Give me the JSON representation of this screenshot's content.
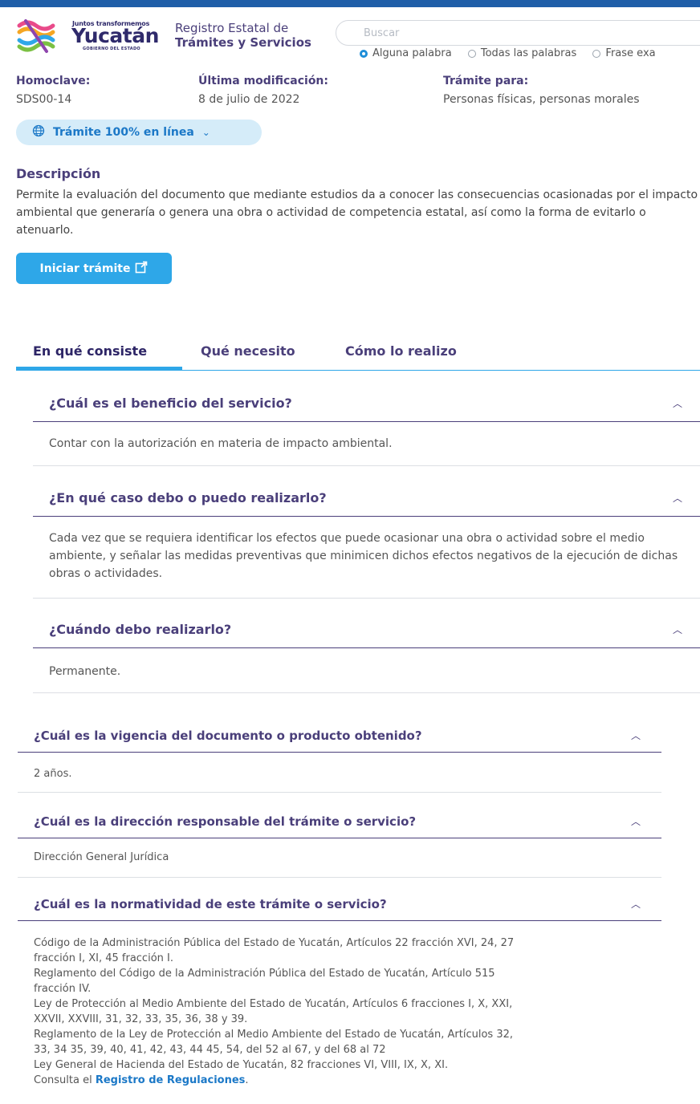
{
  "brand": {
    "tagline": "Juntos transformemos",
    "name": "Yucatán",
    "subtitle": "GOBIERNO DEL ESTADO",
    "registry_line1": "Registro Estatal de",
    "registry_line2": "Trámites y Servicios"
  },
  "search": {
    "placeholder": "Buscar",
    "options": [
      "Alguna palabra",
      "Todas las palabras",
      "Frase exa"
    ],
    "selected": "Alguna palabra"
  },
  "meta": {
    "homoclave_label": "Homoclave:",
    "homoclave_value": "SDS00-14",
    "modified_label": "Última modificación:",
    "modified_value": "8 de julio de 2022",
    "for_label": "Trámite para:",
    "for_value": "Personas físicas, personas morales"
  },
  "online_chip": "Trámite 100% en línea",
  "description": {
    "title": "Descripción",
    "text": "Permite la evaluación del documento que mediante estudios da a conocer las consecuencias ocasionadas por el impacto ambiental que generaría o genera una obra o actividad de competencia estatal, así como la forma de evitarlo o atenuarlo."
  },
  "start_button": "Iniciar trámite",
  "tabs": [
    "En qué consiste",
    "Qué necesito",
    "Cómo lo realizo"
  ],
  "active_tab": "En qué consiste",
  "accordions": [
    {
      "q": "¿Cuál es el beneficio del servicio?",
      "a": "Contar con la autorización en materia de impacto ambiental."
    },
    {
      "q": "¿En qué caso debo o puedo realizarlo?",
      "a": "Cada vez que se requiera identificar los efectos que puede ocasionar una obra o actividad sobre el medio ambiente, y señalar las medidas preventivas que minimicen dichos efectos negativos de la ejecución de dichas obras o actividades."
    },
    {
      "q": "¿Cuándo debo realizarlo?",
      "a": "Permanente."
    },
    {
      "q": "¿Cuál es la vigencia del documento o producto obtenido?",
      "a": "2 años."
    },
    {
      "q": "¿Cuál es la dirección responsable del trámite o servicio?",
      "a": "Dirección General Jurídica"
    },
    {
      "q": "¿Cuál es la normatividad de este trámite o servicio?",
      "a": ""
    }
  ],
  "normatividad": {
    "lines": [
      "Código de la Administración Pública del Estado de Yucatán, Artículos 22 fracción XVI, 24, 27",
      "fracción I, XI, 45 fracción I.",
      "Reglamento del Código de la Administración Pública del Estado de Yucatán, Artículo 515",
      "fracción IV.",
      "Ley de Protección al Medio Ambiente del Estado de Yucatán, Artículos 6 fracciones I, X, XXI,",
      "XXVII, XXVIII, 31, 32, 33, 35, 36, 38 y 39.",
      "Reglamento de la Ley de Protección al Medio Ambiente del Estado de Yucatán, Artículos 32,",
      "33, 34 35, 39, 40, 41, 42, 43, 44 45, 54, del 52 al 67, y del 68 al 72",
      "Ley General de Hacienda del Estado de Yucatán, 82 fracciones VI, VIII, IX, X, XI."
    ],
    "consult_prefix": "Consulta el ",
    "consult_link": "Registro de Regulaciones",
    "consult_suffix": "."
  },
  "colors": {
    "primary_purple": "#4a3f7a",
    "accent_blue": "#2ea7e8",
    "top_bar": "#1f5ea8",
    "chip_bg": "#d5ecf9"
  }
}
